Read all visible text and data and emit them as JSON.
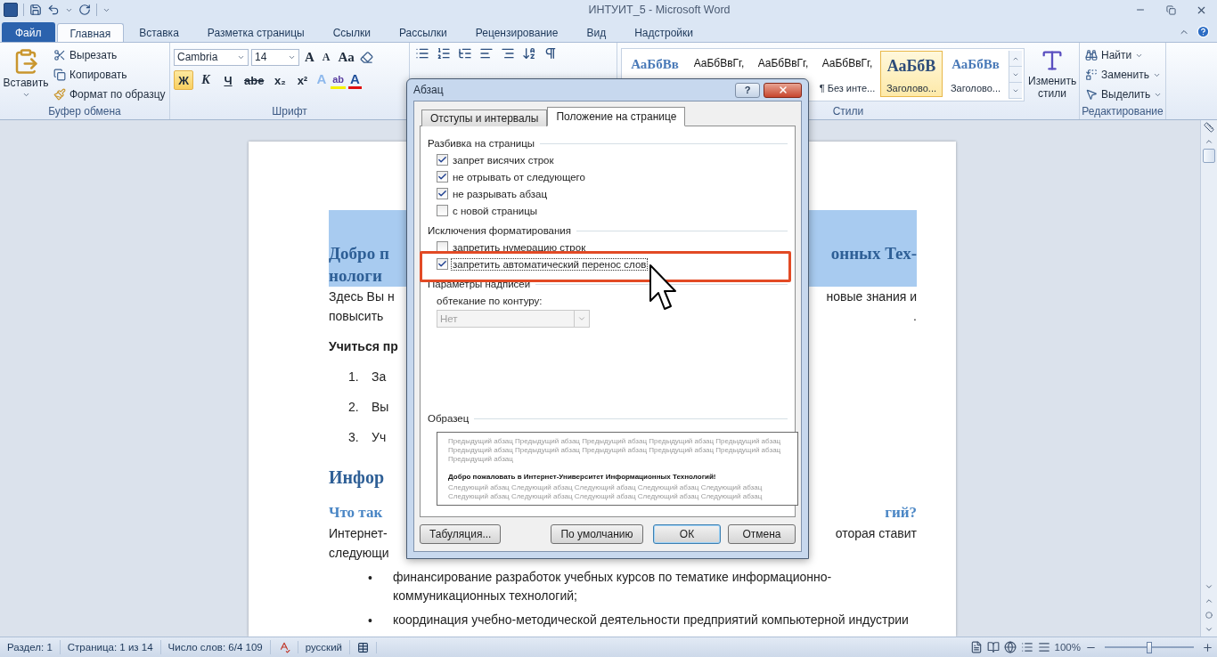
{
  "window": {
    "title": "ИНТУИТ_5  -  Microsoft Word"
  },
  "tabs": [
    {
      "label": "Файл",
      "kind": "file",
      "selected": false
    },
    {
      "label": "Главная",
      "kind": "tab",
      "selected": true
    },
    {
      "label": "Вставка",
      "kind": "tab",
      "selected": false
    },
    {
      "label": "Разметка страницы",
      "kind": "tab",
      "selected": false
    },
    {
      "label": "Ссылки",
      "kind": "tab",
      "selected": false
    },
    {
      "label": "Рассылки",
      "kind": "tab",
      "selected": false
    },
    {
      "label": "Рецензирование",
      "kind": "tab",
      "selected": false
    },
    {
      "label": "Вид",
      "kind": "tab",
      "selected": false
    },
    {
      "label": "Надстройки",
      "kind": "tab",
      "selected": false
    }
  ],
  "clipboard": {
    "label": "Буфер обмена",
    "paste": "Вставить",
    "commands": [
      {
        "label": "Вырезать",
        "kind": "cut"
      },
      {
        "label": "Копировать",
        "kind": "copy"
      },
      {
        "label": "Формат по образцу",
        "kind": "painter"
      }
    ]
  },
  "font": {
    "label": "Шрифт",
    "name": "Cambria",
    "size": "14",
    "grow": "A",
    "shrink": "A",
    "case": "Aa",
    "effects": "A",
    "highlight": "ab",
    "font_color": "A",
    "buttons": [
      {
        "label": "Ж",
        "kind": "bold",
        "selected": true
      },
      {
        "label": "К",
        "kind": "italic",
        "selected": false
      },
      {
        "label": "Ч",
        "kind": "underline",
        "selected": false
      },
      {
        "label": "abe",
        "kind": "strike",
        "selected": false
      },
      {
        "label": "x₂",
        "kind": "sub",
        "selected": false
      },
      {
        "label": "x²",
        "kind": "sup",
        "selected": false
      }
    ]
  },
  "styles": {
    "label": "Стили",
    "change": "Изменить стили",
    "items": [
      {
        "sample": "АаБбВв",
        "kind": "heading",
        "selected": false
      },
      {
        "sample": "АаБбВвГг,",
        "kind": "body",
        "selected": false
      },
      {
        "sample": "АаБбВвГг,",
        "kind": "body",
        "selected": false
      },
      {
        "sample": "АаБбВвГг,",
        "caption": "¶ Без инте...",
        "kind": "body",
        "selected": false
      },
      {
        "sample": "АаБбВ",
        "caption": "Заголово...",
        "kind": "title",
        "selected": true
      },
      {
        "sample": "АаБбВв",
        "caption": "Заголово...",
        "kind": "heading",
        "selected": false
      }
    ]
  },
  "editing": {
    "label": "Редактирование",
    "commands": [
      {
        "label": "Найти",
        "kind": "find"
      },
      {
        "label": "Заменить",
        "kind": "replace"
      },
      {
        "label": "Выделить",
        "kind": "select"
      }
    ]
  },
  "document": {
    "blocks": [
      {
        "kind": "title",
        "selected": true,
        "lines": [
          {
            "left": "Добро п",
            "right": "онных Тех-"
          },
          {
            "left": "нологи"
          }
        ]
      },
      {
        "kind": "para",
        "lines": [
          {
            "left": "Здесь Вы н",
            "right": "новые знания и"
          },
          {
            "left": "повысить",
            "right": "."
          }
        ]
      },
      {
        "kind": "bold",
        "lines": [
          {
            "left": "Учиться пр"
          }
        ]
      },
      {
        "kind": "numbered",
        "marker": "1.",
        "lines": [
          {
            "left": "За"
          }
        ]
      },
      {
        "kind": "numbered",
        "marker": "2.",
        "lines": [
          {
            "left": "Вы"
          }
        ]
      },
      {
        "kind": "numbered",
        "marker": "3.",
        "lines": [
          {
            "left": "Уч"
          }
        ]
      },
      {
        "kind": "h2",
        "lines": [
          {
            "left": "Инфор"
          }
        ]
      },
      {
        "kind": "h3",
        "lines": [
          {
            "left": "Что так",
            "right": "гий?"
          }
        ]
      },
      {
        "kind": "para",
        "lines": [
          {
            "left": "Интернет-",
            "right": "оторая ставит"
          },
          {
            "left": "следующи"
          }
        ]
      },
      {
        "kind": "bullet",
        "marker": "•",
        "lines": [
          "финансирование разработок учебных курсов по тематике информационно-",
          "коммуникационных технологий;"
        ]
      },
      {
        "kind": "bullet",
        "marker": "•",
        "lines": [
          "координация учебно-методической деятельности предприятий компьютерной индустрии"
        ]
      }
    ]
  },
  "dialog": {
    "title": "Абзац",
    "help": "?",
    "tabs": [
      {
        "label": "Отступы и интервалы",
        "selected": false
      },
      {
        "label": "Положение на странице",
        "selected": true
      }
    ],
    "pagination": {
      "title": "Разбивка на страницы",
      "options": [
        {
          "label": "запрет висячих строк",
          "checked": true,
          "focused": false,
          "highlighted": false
        },
        {
          "label": "не отрывать от следующего",
          "checked": true,
          "focused": false,
          "highlighted": false
        },
        {
          "label": "не разрывать абзац",
          "checked": true,
          "focused": false,
          "highlighted": false
        },
        {
          "label": "с новой страницы",
          "checked": false,
          "focused": false,
          "highlighted": false
        }
      ]
    },
    "exceptions": {
      "title": "Исключения форматирования",
      "options": [
        {
          "label": "запретить нумерацию строк",
          "checked": false,
          "focused": false,
          "highlighted": false
        },
        {
          "label": "запретить автоматический перенос слов",
          "checked": true,
          "focused": true,
          "highlighted": true
        }
      ]
    },
    "textbox": {
      "title": "Параметры надписей",
      "field_label": "обтекание по контуру:",
      "value": "Нет",
      "disabled": true
    },
    "preview": {
      "title": "Образец",
      "previous": "Предыдущий абзац Предыдущий абзац Предыдущий абзац Предыдущий абзац Предыдущий абзац Предыдущий абзац Предыдущий абзац Предыдущий абзац Предыдущий абзац Предыдущий абзац Предыдущий абзац",
      "sample": "Добро пожаловать в Интернет-Университет Информационных Технологий!",
      "next": "Следующий абзац Следующий абзац Следующий абзац Следующий абзац Следующий абзац Следующий абзац Следующий абзац Следующий абзац Следующий абзац Следующий абзац"
    },
    "buttons": [
      {
        "label": "Табуляция...",
        "default": false
      },
      {
        "label": "По умолчанию",
        "default": false
      },
      {
        "label": "ОК",
        "default": true
      },
      {
        "label": "Отмена",
        "default": false
      }
    ]
  },
  "status_bar": {
    "items": [
      "Раздел: 1",
      "Страница: 1 из 14",
      "Число слов: 6/4 109"
    ],
    "language": "русский",
    "zoom": {
      "reading": "100%",
      "level": 0.5
    }
  }
}
